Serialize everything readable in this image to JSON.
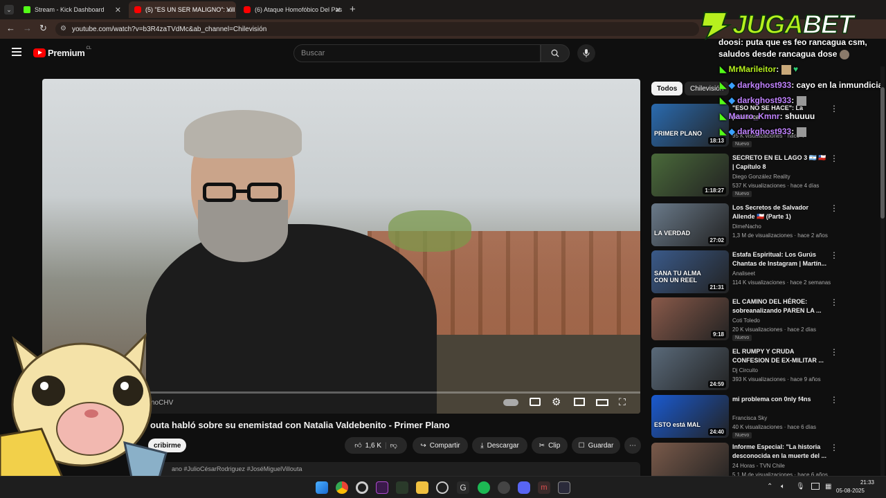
{
  "browser": {
    "tabs": [
      {
        "label": "Stream - Kick Dashboard"
      },
      {
        "label": "(5) \"ES UN SER MALIGNO\": Vill"
      },
      {
        "label": "(6) Ataque Homofóbico Del Pas"
      }
    ],
    "url": "youtube.com/watch?v=b3R4zaTVdMc&ab_channel=Chilevisión"
  },
  "youtube": {
    "logo_text": "Premium",
    "logo_suffix": "CL",
    "search_placeholder": "Buscar",
    "filter_chips": [
      "Todos",
      "Chilevisión"
    ]
  },
  "video": {
    "channel_watermark": "noCHV",
    "title": "outa habló sobre su enemistad con Natalia Valdebenito - Primer Plano",
    "subscribe_label": "cribirme",
    "likes": "1,6 K",
    "share_label": "Compartir",
    "download_label": "Descargar",
    "clip_label": "Clip",
    "save_label": "Guardar",
    "hashtags": "ano #JulioCésarRodriguez #JoséMiguelVillouta"
  },
  "recommendations": [
    {
      "title": "\"ESO NO SE HACE\": La polémica",
      "channel": "",
      "meta": "95 K visualizaciones · hace 4",
      "duration": "18:13",
      "badge": "Nuevo",
      "thumb_text": "PRIMER PLANO",
      "thumb_color": "#2a6bb0"
    },
    {
      "title": "SECRETO EN EL LAGO 3 🇦🇷 🇨🇱 | Capítulo 8",
      "channel": "Diego González Reality",
      "meta": "537 K visualizaciones · hace 4 días",
      "duration": "1:18:27",
      "badge": "Nuevo",
      "thumb_text": "",
      "thumb_color": "#4a6a3a"
    },
    {
      "title": "Los Secretos de Salvador Allende 🇨🇱 (Parte 1)",
      "channel": "DimeNacho",
      "meta": "1,3 M de visualizaciones · hace 2 años",
      "duration": "27:02",
      "badge": "",
      "thumb_text": "LA VERDAD",
      "thumb_color": "#6a7a8a"
    },
    {
      "title": "Estafa Espiritual: Los Gurús Chantas de Instagram | Martín...",
      "channel": "Analiseet",
      "meta": "114 K visualizaciones · hace 2 semanas",
      "duration": "21:31",
      "badge": "",
      "thumb_text": "SANA TU ALMA CON UN REEL",
      "thumb_color": "#3a5a8a"
    },
    {
      "title": "EL CAMINO DEL HÉROE: sobreanalizando PAREN LA ...",
      "channel": "Coti Toledo",
      "meta": "20 K visualizaciones · hace 2 días",
      "duration": "9:18",
      "badge": "Nuevo",
      "thumb_text": "",
      "thumb_color": "#8a5a4a"
    },
    {
      "title": "EL RUMPY Y CRUDA CONFESION DE EX-MILITAR ...",
      "channel": "Dj Circuito",
      "meta": "393 K visualizaciones · hace 9 años",
      "duration": "24:59",
      "badge": "",
      "thumb_text": "",
      "thumb_color": "#5a6a7a"
    },
    {
      "title": "mi problema con 0nly f4ns",
      "channel": "Francisca Sky",
      "meta": "40 K visualizaciones · hace 6 días",
      "duration": "24:40",
      "badge": "Nuevo",
      "thumb_text": "ESTO está MAL",
      "thumb_color": "#1a5ad0"
    },
    {
      "title": "Informe Especial: \"La historia desconocida en la muerte del ...",
      "channel": "24 Horas - TVN Chile",
      "meta": "5,1 M de visualizaciones · hace 6 años",
      "duration": "",
      "badge": "",
      "thumb_text": "",
      "thumb_color": "#7a5a4a"
    }
  ],
  "overlay": {
    "sponsor": "JUGABET",
    "sponsor_part1": "JUGA",
    "sponsor_part2": "BET",
    "chat": [
      {
        "user": "doosi",
        "text": ": puta que es feo rancagua csm,"
      },
      {
        "user": "",
        "text": "saludos desde rancagua dose"
      },
      {
        "user": "MrMarileitor",
        "text": ":"
      },
      {
        "user": "darkghost933",
        "text": ": cayo en la inmundicia"
      },
      {
        "user": "darkghost933",
        "text": ":"
      },
      {
        "user": "Mauro_Kmnr",
        "text": ": shuuuu"
      },
      {
        "user": "darkghost933",
        "text": ":"
      }
    ]
  },
  "taskbar": {
    "time": "21:33",
    "date": "05-08-2025"
  }
}
